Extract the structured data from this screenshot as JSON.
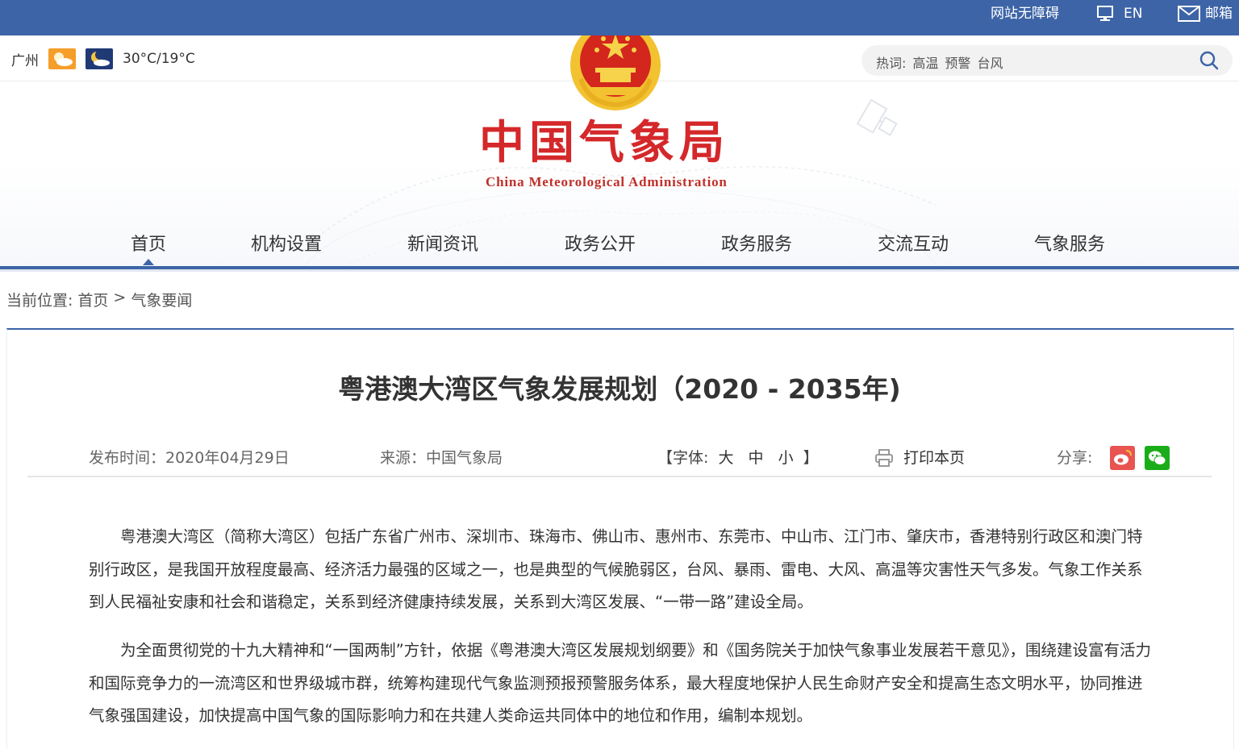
{
  "topbar": {
    "accessibility": "网站无障碍",
    "english": "EN",
    "mail": "邮箱"
  },
  "weather": {
    "city": "广州",
    "temps": "30°C/19°C"
  },
  "header": {
    "title": "中国气象局",
    "subtitle": "China Meteorological Administration"
  },
  "search": {
    "label": "热词:",
    "hotwords": [
      "高温",
      "预警",
      "台风"
    ]
  },
  "nav": {
    "items": [
      "首页",
      "机构设置",
      "新闻资讯",
      "政务公开",
      "政务服务",
      "交流互动",
      "气象服务"
    ],
    "active": "首页"
  },
  "breadcrumb": {
    "label": "当前位置:",
    "home": "首页",
    "separator": ">",
    "current": "气象要闻"
  },
  "article": {
    "title": "粤港澳大湾区气象发展规划（2020 - 2035年)",
    "date": "发布时间：2020年04月29日",
    "source": "来源：中国气象局",
    "font_label_open": "【字体:",
    "font_sizes": [
      "大",
      "中",
      "小"
    ],
    "font_label_close": "】",
    "print": "打印本页",
    "share": "分享:",
    "paragraphs": [
      "粤港澳大湾区（简称大湾区）包括广东省广州市、深圳市、珠海市、佛山市、惠州市、东莞市、中山市、江门市、肇庆市，香港特别行政区和澳门特别行政区，是我国开放程度最高、经济活力最强的区域之一，也是典型的气候脆弱区，台风、暴雨、雷电、大风、高温等灾害性天气多发。气象工作关系到人民福祉安康和社会和谐稳定，关系到经济健康持续发展，关系到大湾区发展、“一带一路”建设全局。",
      "为全面贯彻党的十九大精神和“一国两制”方针，依据《粤港澳大湾区发展规划纲要》和《国务院关于加快气象事业发展若干意见》，围绕建设富有活力和国际竞争力的一流湾区和世界级城市群，统筹构建现代气象监测预报预警服务体系，最大程度地保护人民生命财产安全和提高生态文明水平，协同推进气象强国建设，加快提高中国气象的国际影响力和在共建人类命运共同体中的地位和作用，编制本规划。"
    ]
  },
  "colors": {
    "brand_blue": "#3d64a6",
    "title_red": "#d4282a",
    "weibo": "#e85450",
    "wechat": "#1aad19"
  },
  "icons": {
    "accessibility": "monitor-icon",
    "english": "globe-icon",
    "mail": "mail-icon",
    "search": "search-icon",
    "print": "printer-icon",
    "weibo": "weibo-icon",
    "wechat": "wechat-icon",
    "weather_day": "sun-cloud-icon",
    "weather_night": "moon-cloud-icon",
    "emblem": "national-emblem-icon"
  }
}
